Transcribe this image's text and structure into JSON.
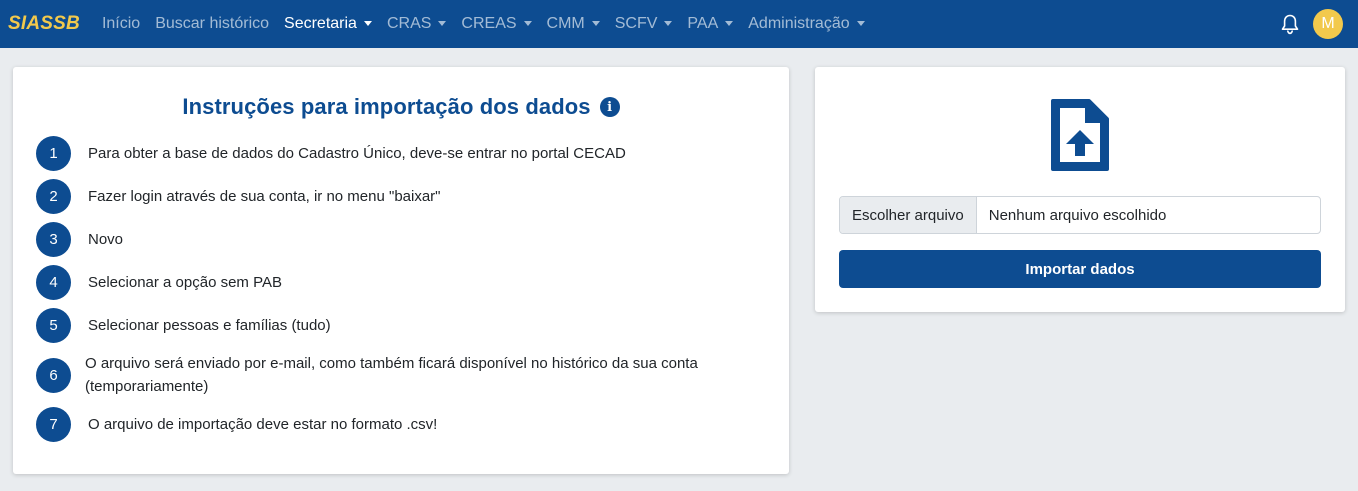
{
  "navbar": {
    "brand": "SIASSB",
    "items": [
      {
        "label": "Início",
        "dropdown": false,
        "active": false
      },
      {
        "label": "Buscar histórico",
        "dropdown": false,
        "active": false
      },
      {
        "label": "Secretaria",
        "dropdown": true,
        "active": true
      },
      {
        "label": "CRAS",
        "dropdown": true,
        "active": false
      },
      {
        "label": "CREAS",
        "dropdown": true,
        "active": false
      },
      {
        "label": "CMM",
        "dropdown": true,
        "active": false
      },
      {
        "label": "SCFV",
        "dropdown": true,
        "active": false
      },
      {
        "label": "PAA",
        "dropdown": true,
        "active": false
      },
      {
        "label": "Administração",
        "dropdown": true,
        "active": false
      }
    ],
    "notification_icon": "bell-icon",
    "avatar_initial": "M"
  },
  "instructions": {
    "title": "Instruções para importação dos dados",
    "info_icon": "info-icon",
    "steps": [
      {
        "num": "1",
        "text": "Para obter a base de dados do Cadastro Único, deve-se entrar no portal CECAD"
      },
      {
        "num": "2",
        "text": "Fazer login através de sua conta, ir no menu \"baixar\""
      },
      {
        "num": "3",
        "text": "Novo"
      },
      {
        "num": "4",
        "text": "Selecionar a opção sem PAB"
      },
      {
        "num": "5",
        "text": "Selecionar pessoas e famílias (tudo)"
      },
      {
        "num": "6",
        "text": "O arquivo será enviado por e-mail, como também ficará disponível no histórico da sua conta (temporariamente)"
      },
      {
        "num": "7",
        "text": "O arquivo de importação deve estar no formato .csv!"
      }
    ]
  },
  "upload": {
    "icon": "file-upload-icon",
    "choose_label": "Escolher arquivo",
    "file_status": "Nenhum arquivo escolhido",
    "import_label": "Importar dados"
  },
  "colors": {
    "primary": "#0d4c91",
    "brand": "#f2c94c",
    "background": "#e9ecef"
  }
}
